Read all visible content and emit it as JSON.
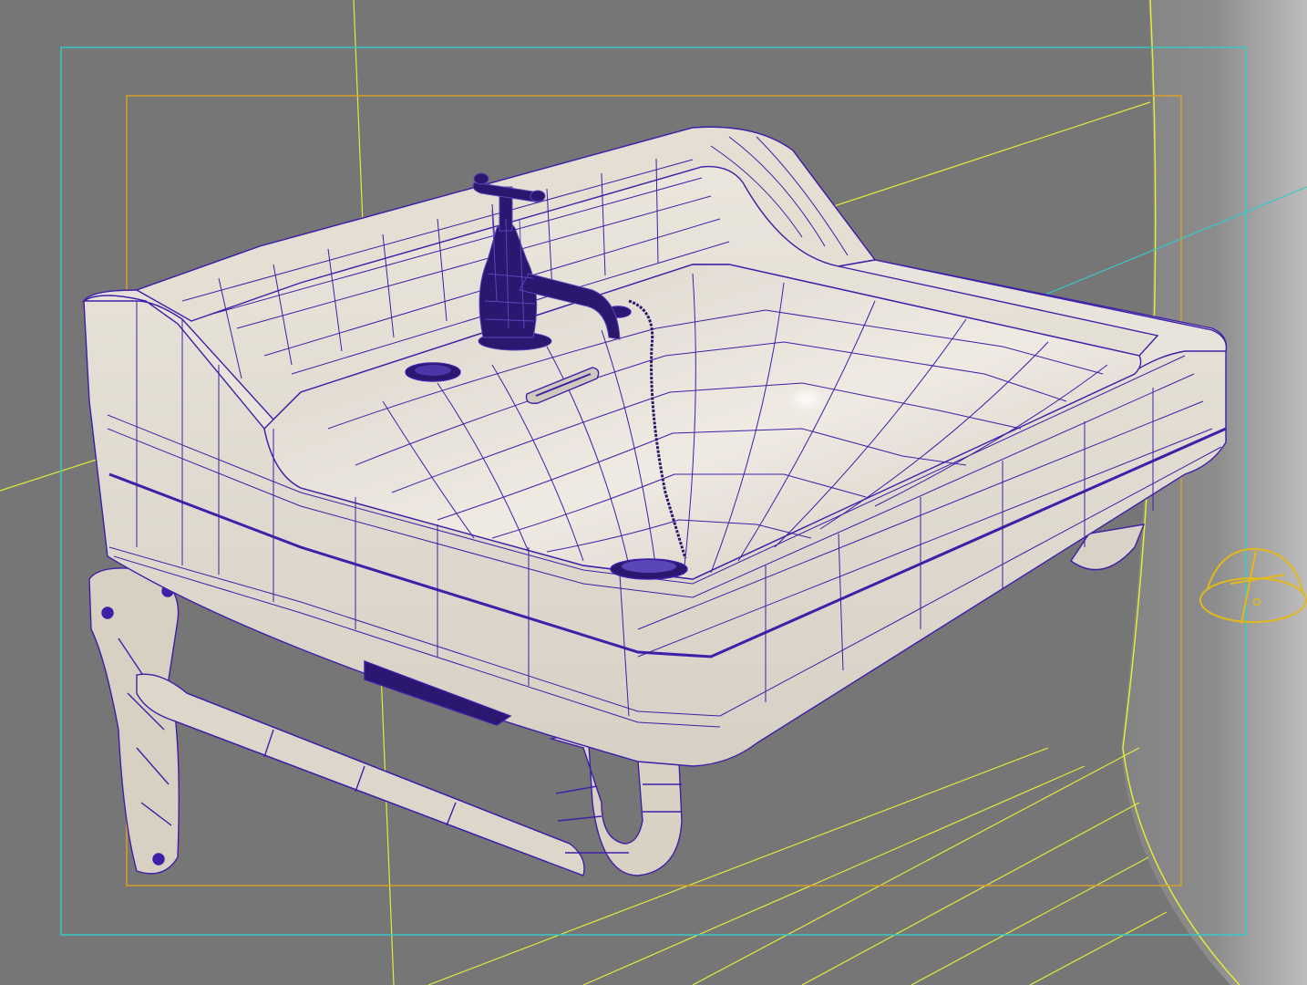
{
  "viewport": {
    "background_color": "#767676",
    "wall_color": "#8a8a8a",
    "wall_light_color": "#b9b9b9",
    "safe_frame_outer_color": "#36c9c6",
    "safe_frame_inner_color": "#d7a02a",
    "helper_line_color": "#e3ea3a",
    "wireframe_color": "#3e1fa8",
    "porcelain_color": "#e6e0d6",
    "fixture_color": "#2b1670"
  },
  "scene": {
    "object": "sink",
    "parts": [
      "basin",
      "backsplash",
      "faucet",
      "drain",
      "overflow-slot",
      "chain",
      "towel-rail",
      "wall-bracket",
      "p-trap"
    ],
    "gizmo_icon": "light-gizmo-icon"
  }
}
